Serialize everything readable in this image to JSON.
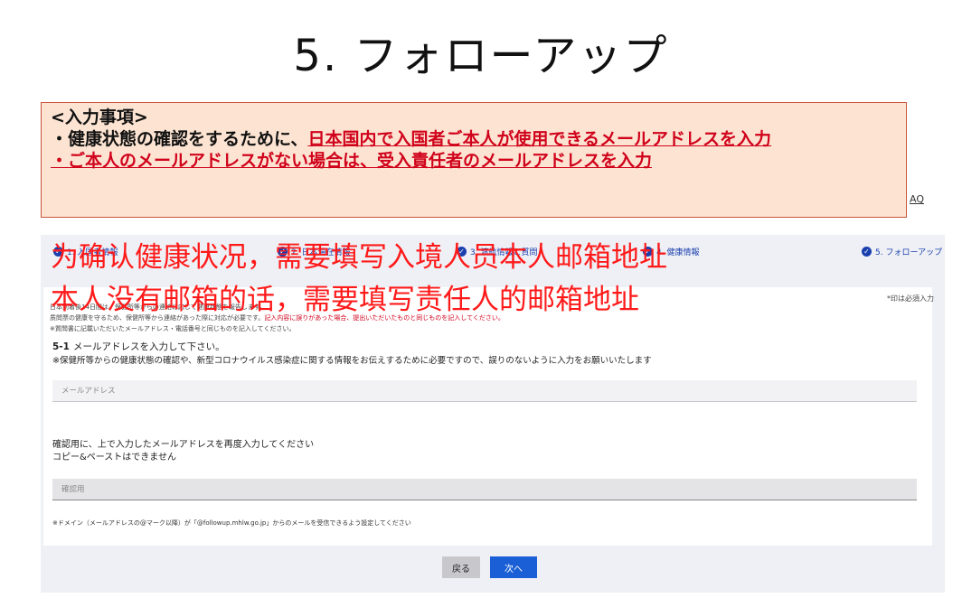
{
  "slide_title": "5. フォローアップ",
  "callout": {
    "heading": "<入力事項>",
    "line1_prefix": "・健康状態の確認をするために、",
    "line1_emphasis": "日本国内で入国者ご本人が使用できるメールアドレスを入力",
    "line2": "・ご本人のメールアドレスがない場合は、受入責任者のメールアドレスを入力"
  },
  "overlay_chinese": {
    "line1": "为确认健康状况，需要填写入境人员本人邮箱地址",
    "line2": "本人没有邮箱的话，需要填写责任人的邮箱地址"
  },
  "header_link": "AQ",
  "steps": [
    {
      "label": "1. 入国者情報"
    },
    {
      "label": "2. 日本滞在情報"
    },
    {
      "label": "3. 渡航情報と質問"
    },
    {
      "label": "4. 健康情報"
    },
    {
      "label": "5. フォローアップ"
    }
  ],
  "form": {
    "required_note": "*印は必須入力",
    "intro_line1": "日本到着後14日間は、保健所等からの連絡に応じて健康状態を報告します。",
    "intro_line2_prefix": "质問票の健康を守るため、保健所等から連絡があった際に対応が必要です。",
    "intro_line2_red": "記入内容に誤りがあった場合、提出いただいたものと同じものを記入してください。",
    "intro_line3": "※質問書に記載いただいたメールアドレス・電話番号と同じものを記入してください。",
    "question_number": "5-1",
    "question_text": "メールアドレスを入力して下さい。",
    "question_note": "※保健所等からの健康状態の確認や、新型コロナウイルス感染症に関する情報をお伝えするために必要ですので、誤りのないように入力をお願いいたします",
    "email_placeholder": "メールアドレス",
    "confirm_label_line1": "確認用に、上で入力したメールアドレスを再度入力してください",
    "confirm_label_line2": "コピー&ペーストはできません",
    "confirm_placeholder": "確認用",
    "domain_note": "※ドメイン（メールアドレスの@マーク以降）が「@followup.mhlw.go.jp」からのメールを受信できるよう設定してください"
  },
  "buttons": {
    "back": "戻る",
    "next": "次へ"
  },
  "colors": {
    "accent_blue": "#1a3fae",
    "button_blue": "#1a5fd6",
    "alert_red": "#d0021b",
    "callout_bg": "#fde4d2",
    "overlay_red": "#ff1a1a"
  }
}
